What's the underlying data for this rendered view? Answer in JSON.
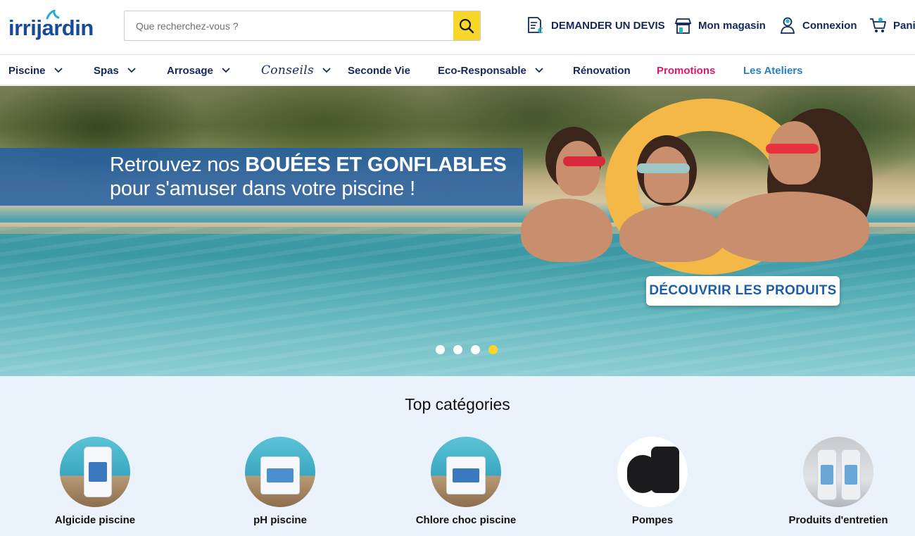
{
  "header": {
    "logo_text": "irrijardin",
    "search_placeholder": "Que recherchez-vous ?",
    "links": {
      "devis": "DEMANDER UN DEVIS",
      "magasin": "Mon magasin",
      "connexion": "Connexion",
      "panier": "Panier"
    }
  },
  "nav": {
    "items": [
      {
        "label": "Piscine",
        "dropdown": true
      },
      {
        "label": "Spas",
        "dropdown": true
      },
      {
        "label": "Arrosage",
        "dropdown": true
      },
      {
        "label": "Conseils",
        "dropdown": true
      },
      {
        "label": "Seconde Vie",
        "dropdown": false
      },
      {
        "label": "Eco-Responsable",
        "dropdown": true
      },
      {
        "label": "Rénovation",
        "dropdown": false
      },
      {
        "label": "Promotions",
        "dropdown": false
      },
      {
        "label": "Les Ateliers",
        "dropdown": false
      }
    ]
  },
  "hero": {
    "line1_prefix": "Retrouvez nos ",
    "line1_bold": "BOUÉES ET GONFLABLES",
    "line2": "pour s'amuser dans votre piscine !",
    "cta": "DÉCOUVRIR LES PRODUITS",
    "slides_total": 4,
    "active_slide": 4
  },
  "categories": {
    "title": "Top catégories",
    "items": [
      {
        "label": "Algicide piscine"
      },
      {
        "label": "pH piscine"
      },
      {
        "label": "Chlore choc piscine"
      },
      {
        "label": "Pompes"
      },
      {
        "label": "Produits d'entretien"
      }
    ]
  },
  "colors": {
    "brand_navy": "#12295a",
    "brand_blue": "#174a9b",
    "accent_yellow": "#f7d72a",
    "promo_pink": "#e3136f",
    "ateliers_blue": "#2a7fc1",
    "categories_bg": "#eaf2fb"
  },
  "icons": {
    "search": "search-icon",
    "devis": "quote-document-icon",
    "magasin": "store-icon",
    "connexion": "user-icon",
    "panier": "cart-icon",
    "chevron": "chevron-down-icon"
  }
}
